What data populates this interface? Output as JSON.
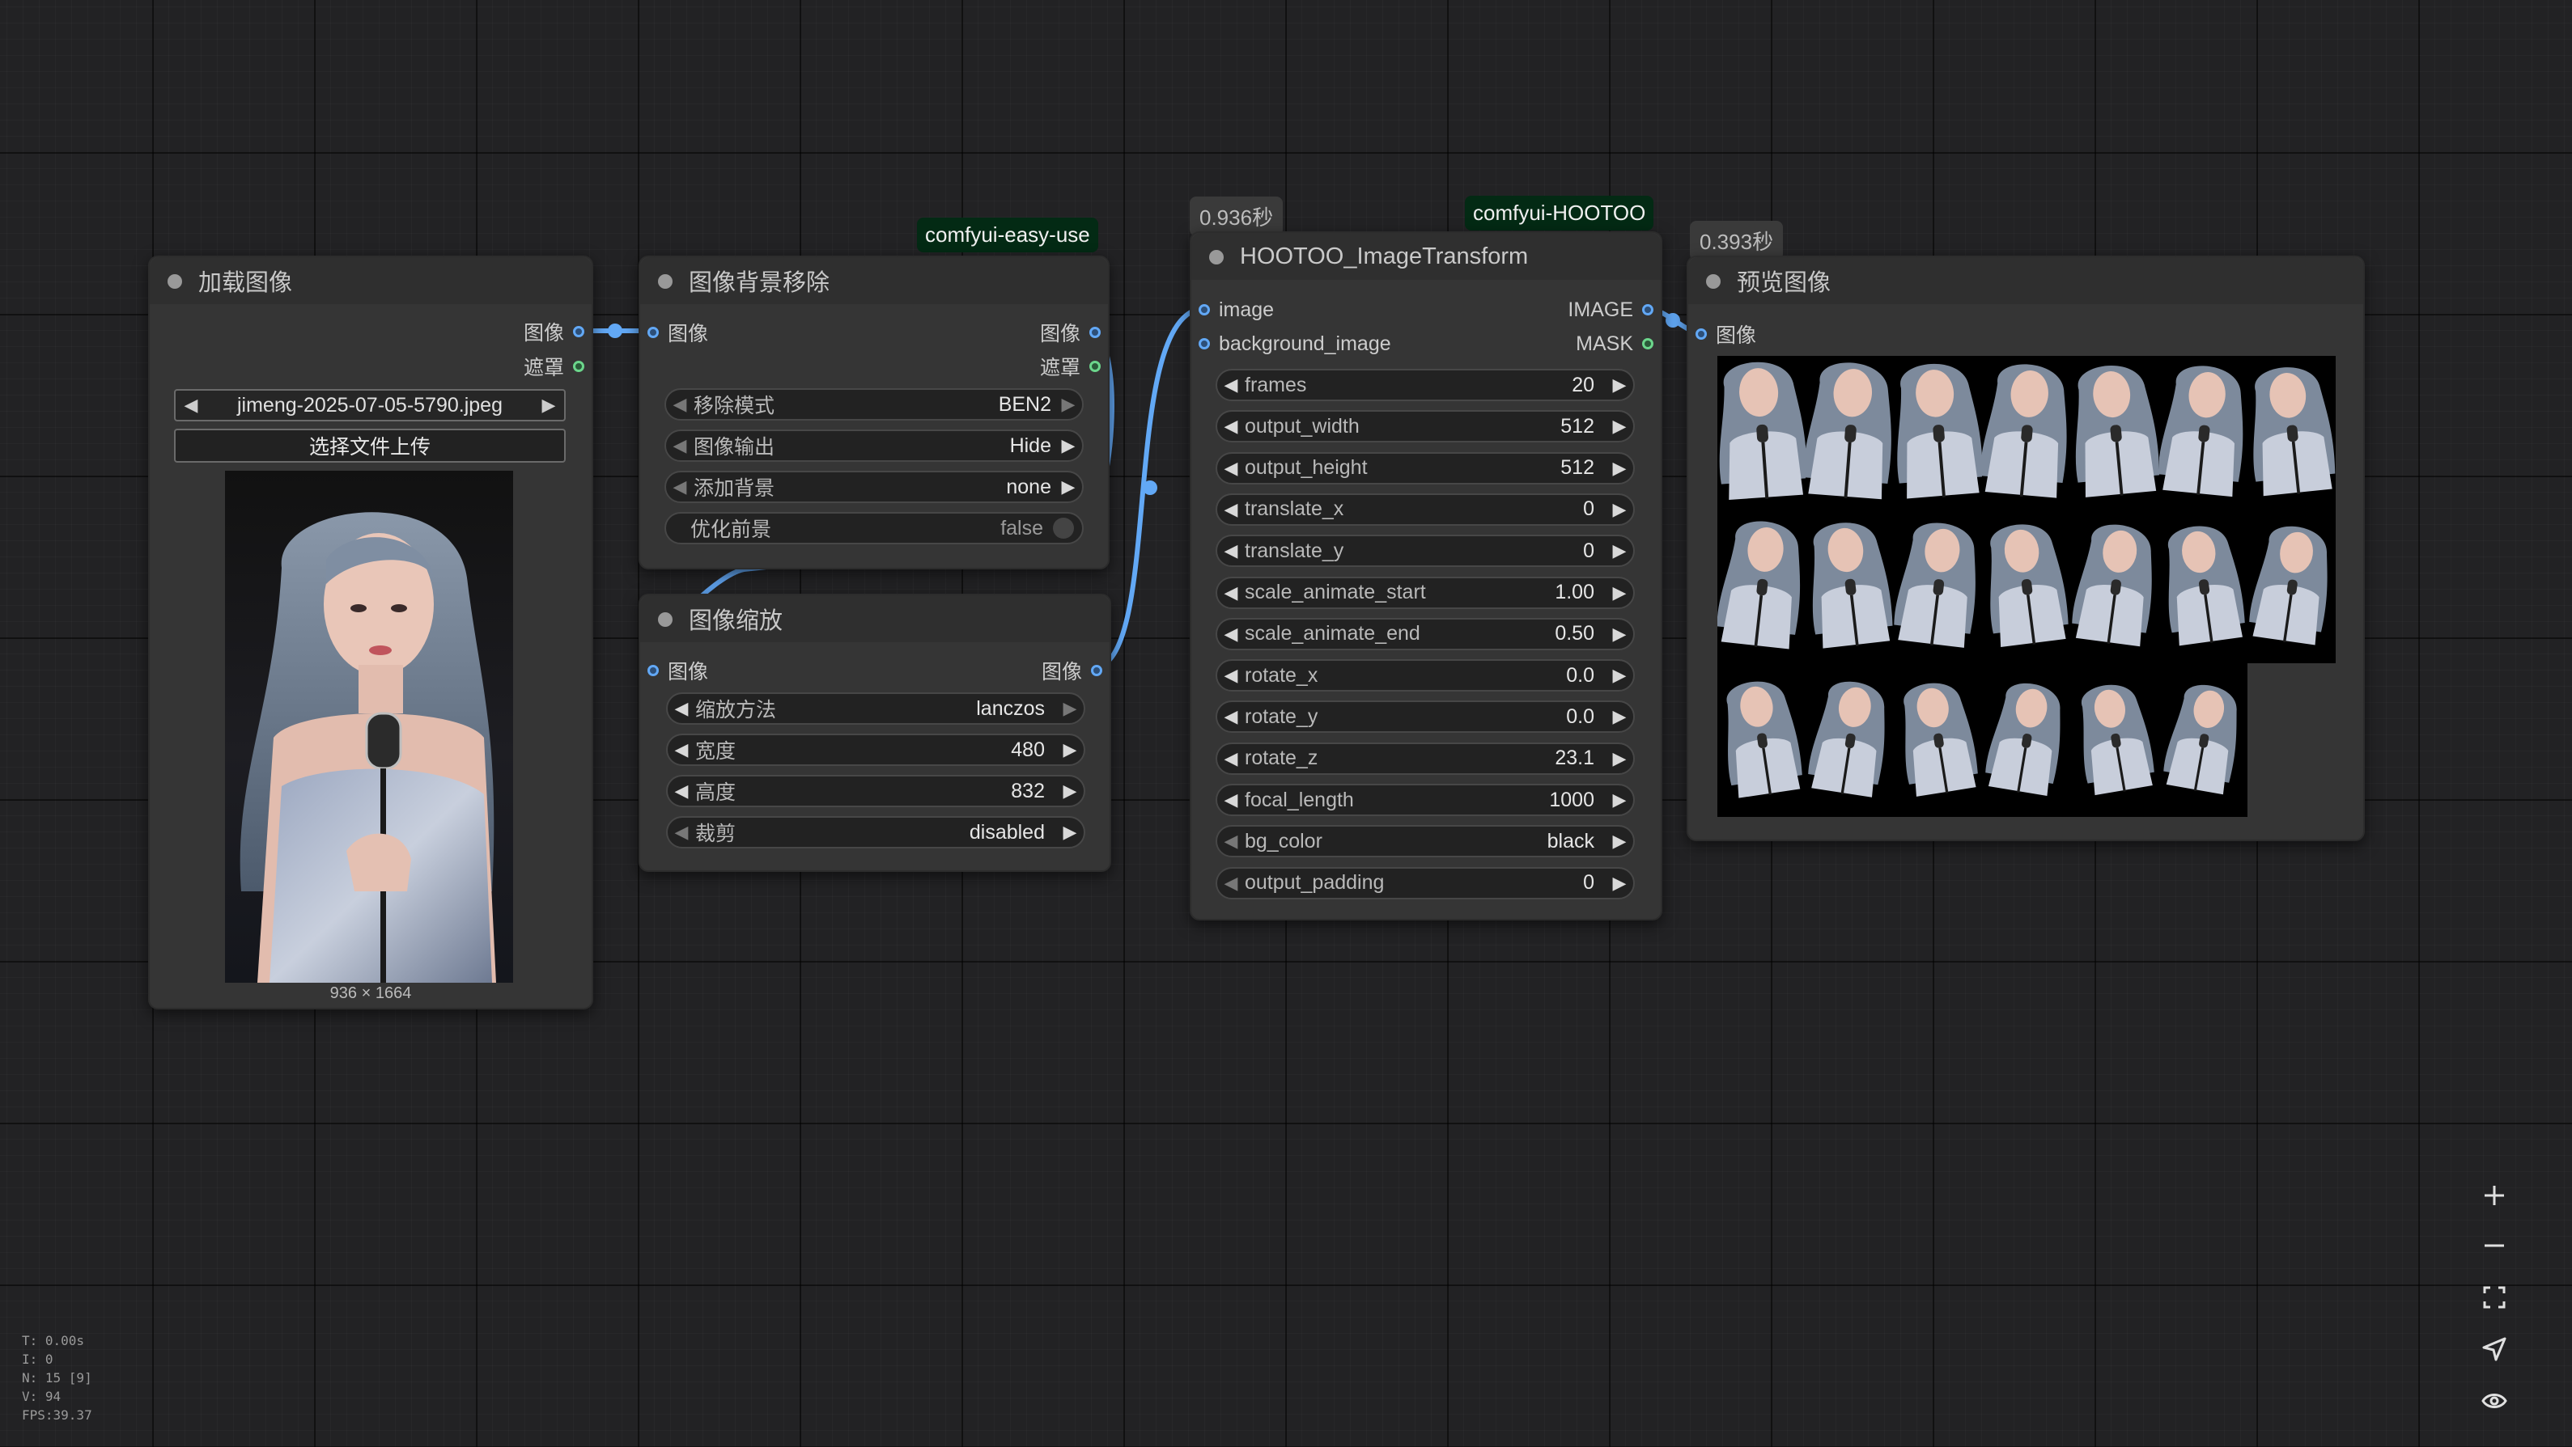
{
  "colors": {
    "canvas_bg": "#222224",
    "node_bg": "#353535",
    "image_link": "#62a8f5",
    "mask_link": "#6bd68b",
    "badge_green": "#032a14"
  },
  "nodes": {
    "load_image": {
      "title": "加载图像",
      "outputs": [
        "图像",
        "遮罩"
      ],
      "file_value": "jimeng-2025-07-05-5790.jpeg",
      "upload_label": "选择文件上传",
      "image_size": "936 × 1664"
    },
    "bg_remove": {
      "badge": "comfyui-easy-use",
      "title": "图像背景移除",
      "input": "图像",
      "outputs": [
        "图像",
        "遮罩"
      ],
      "widgets": [
        {
          "label": "移除模式",
          "value": "BEN2"
        },
        {
          "label": "图像输出",
          "value": "Hide"
        },
        {
          "label": "添加背景",
          "value": "none"
        }
      ],
      "toggle": {
        "label": "优化前景",
        "value": "false"
      }
    },
    "scale": {
      "title": "图像缩放",
      "input": "图像",
      "output": "图像",
      "widgets": [
        {
          "label": "缩放方法",
          "value": "lanczos"
        },
        {
          "label": "宽度",
          "value": "480"
        },
        {
          "label": "高度",
          "value": "832"
        },
        {
          "label": "裁剪",
          "value": "disabled"
        }
      ]
    },
    "transform": {
      "time": "0.936秒",
      "badge": "comfyui-HOOTOO",
      "title": "HOOTOO_ImageTransform",
      "inputs": [
        "image",
        "background_image"
      ],
      "outputs": [
        "IMAGE",
        "MASK"
      ],
      "widgets": [
        {
          "label": "frames",
          "value": "20"
        },
        {
          "label": "output_width",
          "value": "512"
        },
        {
          "label": "output_height",
          "value": "512"
        },
        {
          "label": "translate_x",
          "value": "0"
        },
        {
          "label": "translate_y",
          "value": "0"
        },
        {
          "label": "scale_animate_start",
          "value": "1.00"
        },
        {
          "label": "scale_animate_end",
          "value": "0.50"
        },
        {
          "label": "rotate_x",
          "value": "0.0"
        },
        {
          "label": "rotate_y",
          "value": "0.0"
        },
        {
          "label": "rotate_z",
          "value": "23.1"
        },
        {
          "label": "focal_length",
          "value": "1000"
        },
        {
          "label": "bg_color",
          "value": "black"
        },
        {
          "label": "output_padding",
          "value": "0"
        }
      ]
    },
    "preview": {
      "time": "0.393秒",
      "title": "预览图像",
      "input": "图像",
      "frame_count": 20
    }
  },
  "stats": {
    "t": "T: 0.00s",
    "i": "I: 0",
    "n": "N: 15 [9]",
    "v": "V: 94",
    "fps": "FPS:39.37"
  },
  "toolbar": [
    "zoom-in-icon",
    "zoom-out-icon",
    "fit-view-icon",
    "locate-icon",
    "eye-icon"
  ]
}
